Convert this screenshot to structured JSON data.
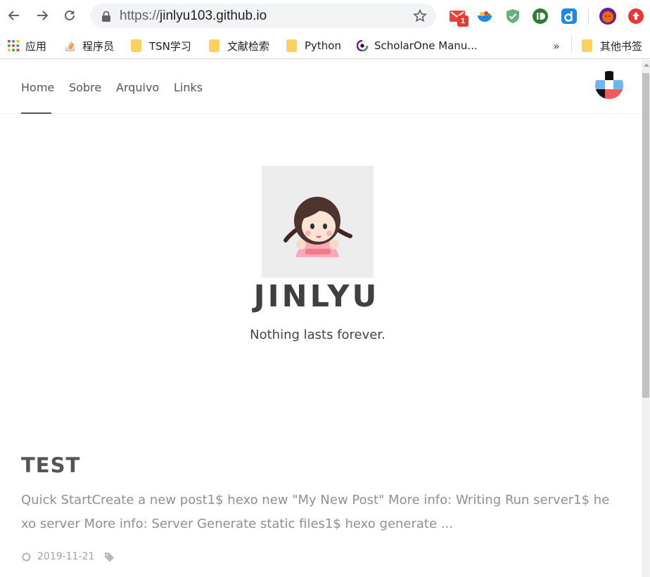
{
  "browser": {
    "url_prefix": "https://",
    "url_host": "jinlyu103.github.io",
    "mail_badge": "1"
  },
  "bookmarks": {
    "items": [
      {
        "label": "应用",
        "icon": "apps-grid-icon"
      },
      {
        "label": "程序员",
        "icon": "stackoverflow-icon"
      },
      {
        "label": "TSN学习",
        "icon": "folder-icon"
      },
      {
        "label": "文献检索",
        "icon": "folder-icon"
      },
      {
        "label": "Python",
        "icon": "folder-icon"
      },
      {
        "label": "ScholarOne Manu...",
        "icon": "scholarone-icon"
      }
    ],
    "overflow": "»",
    "other": "其他书签"
  },
  "site": {
    "nav": [
      {
        "label": "Home",
        "active": true
      },
      {
        "label": "Sobre",
        "active": false
      },
      {
        "label": "Arquivo",
        "active": false
      },
      {
        "label": "Links",
        "active": false
      }
    ],
    "title": "JINLYU",
    "subtitle": "Nothing lasts forever."
  },
  "post": {
    "title": "TEST",
    "excerpt": "Quick StartCreate a new post1$ hexo new \"My New Post\" More info: Writing Run server1$ hexo server More info: Server Generate static files1$ hexo generate ...",
    "date": "2019-11-21"
  },
  "colors": {
    "accent_text": "#404040",
    "muted_text": "#909090",
    "folder": "#fbd15b"
  }
}
